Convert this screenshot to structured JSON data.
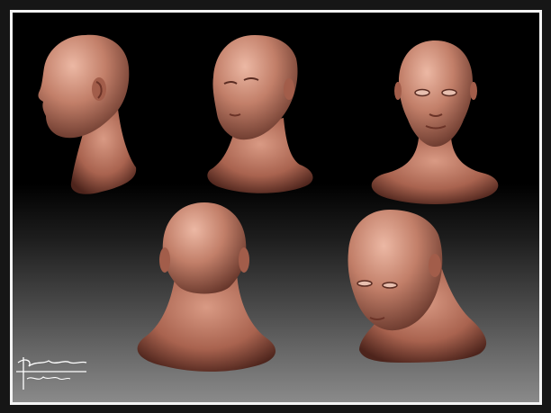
{
  "image": {
    "subject": "clay-render-head-turnaround",
    "views": [
      "left-profile",
      "three-quarter-left",
      "front",
      "back",
      "three-quarter-down-left"
    ]
  },
  "colors": {
    "frame": "#f4f4f4",
    "background_top": "#000000",
    "background_bottom": "#8a8a8a",
    "clay_light": "#e3aa95",
    "clay_mid": "#b56e5a",
    "clay_dark": "#5a2c22"
  },
  "signature": {
    "name": "Gabriel Lerma",
    "date": "6-22-2012"
  }
}
